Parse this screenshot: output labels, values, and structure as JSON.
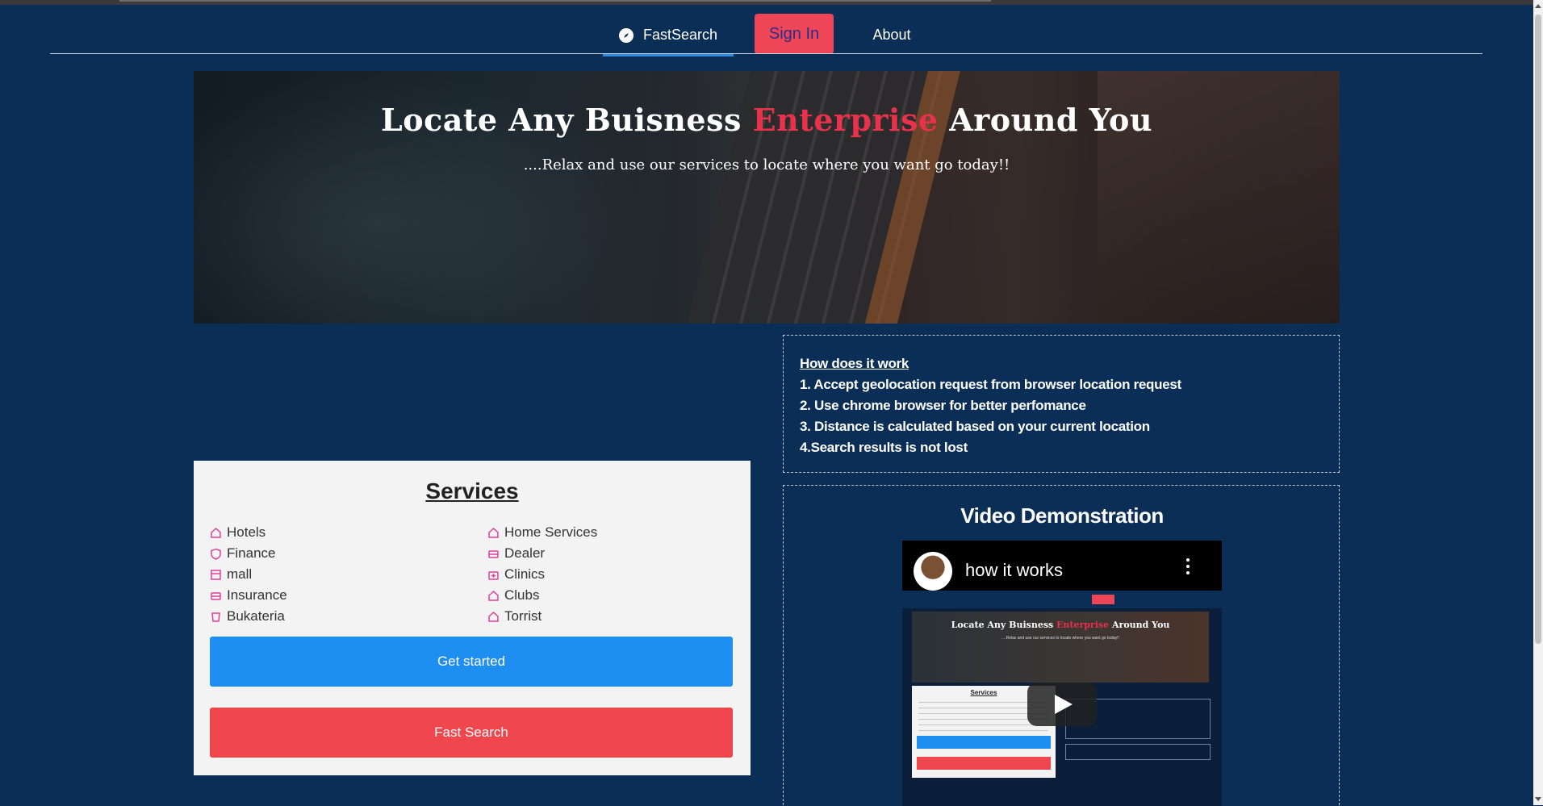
{
  "nav": {
    "brand": "FastSearch",
    "sign_in": "Sign In",
    "about": "About"
  },
  "hero": {
    "title_part1": "Locate Any Buisness ",
    "title_accent": "Enterprise",
    "title_part2": " Around You",
    "subtitle": "....Relax and use our services to locate where you want go today!!",
    "accent_color": "#e8314a"
  },
  "how": {
    "title": "How does it work",
    "steps": [
      "1. Accept geolocation request from browser location request",
      "2. Use chrome browser for better perfomance",
      "3. Distance is calculated based on your current location",
      "4.Search results is not lost"
    ]
  },
  "services": {
    "title": "Services",
    "left": [
      "Hotels",
      "Finance",
      "mall",
      "Insurance",
      "Bukateria"
    ],
    "right": [
      "Home Services",
      "Dealer",
      "Clinics",
      "Clubs",
      "Torrist"
    ],
    "icons_left": [
      "home-icon",
      "shield-icon",
      "store-icon",
      "shop-icon",
      "cup-icon"
    ],
    "icons_right": [
      "home-icon",
      "shop-icon",
      "clinic-icon",
      "home-icon",
      "home-icon"
    ],
    "get_started": "Get started",
    "fast_search": "Fast Search",
    "primary_color": "#1e8ef0",
    "danger_color": "#f0474f"
  },
  "video": {
    "title": "Video Demonstration",
    "player_title": "how it works"
  },
  "colors": {
    "background": "#0b2e57",
    "signin_bg": "#ee4656"
  }
}
